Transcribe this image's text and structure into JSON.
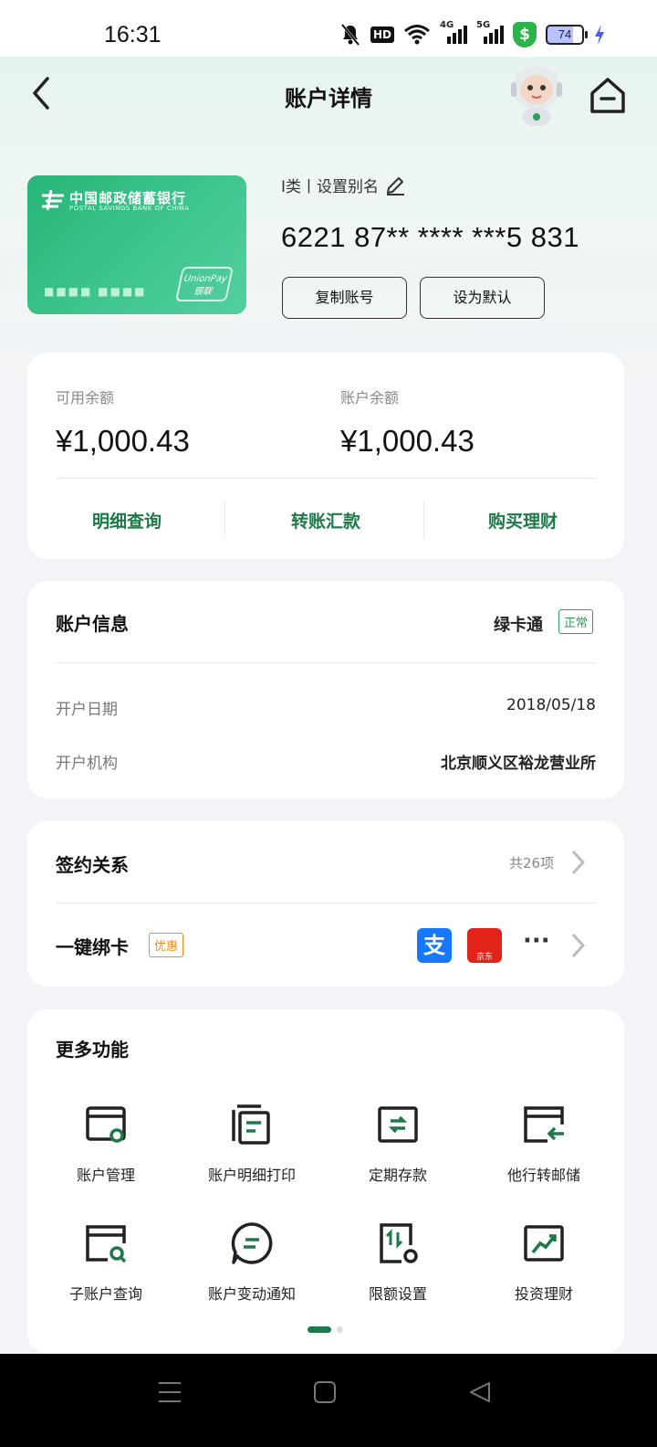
{
  "status_bar": {
    "time": "16:31",
    "network_4g": "4G",
    "network_5g": "5G",
    "hd_label": "HD",
    "battery": "74"
  },
  "header": {
    "title": "账户详情"
  },
  "card": {
    "bank_name": "中国邮政储蓄银行",
    "bank_name_en": "POSTAL SAVINGS BANK OF CHINA",
    "card_dots": "■■■■  ■■■■",
    "unionpay_en": "UnionPay",
    "unionpay_cn": "银联",
    "account_type": "I类丨设置别名",
    "account_number": "6221 87** **** ***5 831",
    "copy_button": "复制账号",
    "default_button": "设为默认"
  },
  "balance": {
    "available_label": "可用余额",
    "available_value": "¥1,000.43",
    "account_label": "账户余额",
    "account_value": "¥1,000.43",
    "actions": [
      "明细查询",
      "转账汇款",
      "购买理财"
    ]
  },
  "account_info": {
    "title": "账户信息",
    "card_product": "绿卡通",
    "status": "正常",
    "open_date_label": "开户日期",
    "open_date_value": "2018/05/18",
    "branch_label": "开户机构",
    "branch_value": "北京顺义区裕龙营业所"
  },
  "relations": {
    "sign_title": "签约关系",
    "sign_count": "共26项",
    "bind_title": "一键绑卡",
    "bind_tag": "优惠",
    "jd_label": "京东",
    "alipay_label": "支",
    "more": "···"
  },
  "more_functions": {
    "title": "更多功能",
    "items": [
      {
        "label": "账户管理",
        "icon": "account-manage-icon"
      },
      {
        "label": "账户明细打印",
        "icon": "statement-print-icon"
      },
      {
        "label": "定期存款",
        "icon": "fixed-deposit-icon"
      },
      {
        "label": "他行转邮储",
        "icon": "transfer-in-icon"
      },
      {
        "label": "子账户查询",
        "icon": "sub-account-search-icon"
      },
      {
        "label": "账户变动通知",
        "icon": "notification-icon"
      },
      {
        "label": "限额设置",
        "icon": "limit-setting-icon"
      },
      {
        "label": "投资理财",
        "icon": "investment-icon"
      }
    ]
  },
  "colors": {
    "accent_green": "#1d7a48",
    "tag_green": "#2a9d5a",
    "promo_orange": "#f08a1a",
    "card_green": "#27b578"
  }
}
